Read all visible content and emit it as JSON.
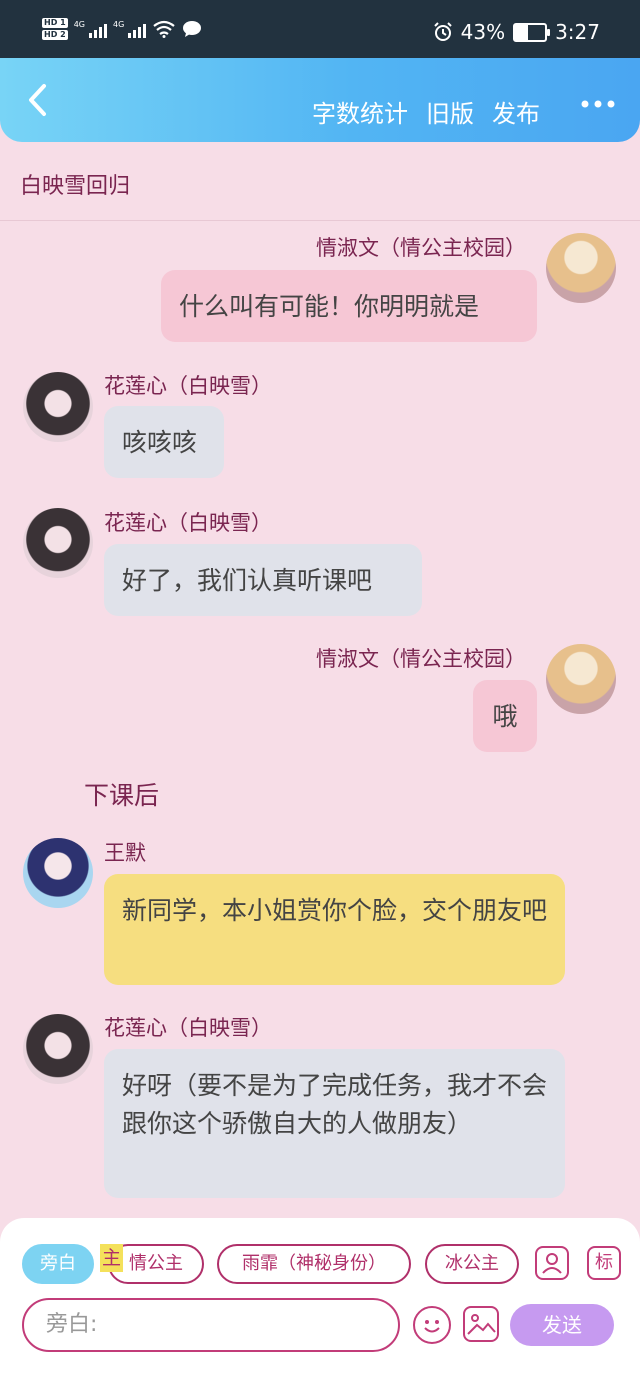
{
  "status_bar": {
    "battery": "43%",
    "time": "3:27",
    "network": "4G",
    "sim_labels": [
      "HD 1",
      "HD 2"
    ],
    "battery_level": 0.43,
    "icons": [
      "alarm-icon",
      "wifi-icon",
      "chat-notification-icon"
    ]
  },
  "header": {
    "actions": [
      "字数统计",
      "旧版",
      "发布"
    ],
    "accent": "#52b5f3"
  },
  "doc_title": "白映雪回归",
  "messages": [
    {
      "name": "情淑文（情公主校园）",
      "text": "什么叫有可能！你明明就是",
      "side": "right",
      "color": "#f6c7d5"
    },
    {
      "name": "花莲心（白映雪）",
      "text": "咳咳咳",
      "side": "left",
      "color": "#e0e2ea"
    },
    {
      "name": "花莲心（白映雪）",
      "text": "好了，我们认真听课吧",
      "side": "left",
      "color": "#e0e2ea"
    },
    {
      "name": "情淑文（情公主校园）",
      "text": "哦",
      "side": "right",
      "color": "#f6c7d5"
    },
    {
      "name": "王默",
      "text": "新同学，本小姐赏你个脸，交个朋友吧",
      "side": "left",
      "color": "#f6de80"
    },
    {
      "name": "花莲心（白映雪）",
      "text": "好呀（要不是为了完成任务，我才不会跟你这个骄傲自大的人做朋友）",
      "side": "left",
      "color": "#e0e2ea"
    }
  ],
  "narration": "下课后",
  "roles": {
    "chips": [
      "旁白",
      "情公主",
      "雨霏（神秘身份）",
      "冰公主"
    ],
    "highlight": "主",
    "buttons": [
      "标"
    ]
  },
  "composer": {
    "placeholder": "旁白:",
    "send_label": "发送",
    "border_color": "#c23c79",
    "send_color": "#c69af0"
  }
}
